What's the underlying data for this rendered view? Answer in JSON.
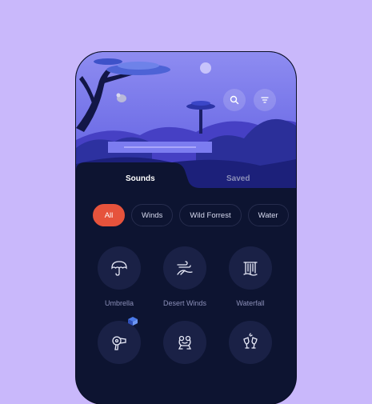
{
  "tabs": {
    "sounds": "Sounds",
    "saved": "Saved"
  },
  "header_icons": [
    "search-icon",
    "filter-icon"
  ],
  "filters": [
    "All",
    "Winds",
    "Wild Forrest",
    "Water"
  ],
  "active_filter": "All",
  "sounds": [
    {
      "label": "Umbrella",
      "icon": "umbrella-icon"
    },
    {
      "label": "Desert Winds",
      "icon": "desert-winds-icon"
    },
    {
      "label": "Waterfall",
      "icon": "waterfall-icon"
    },
    {
      "label": "",
      "icon": "hair-dryer-icon"
    },
    {
      "label": "",
      "icon": "frog-icon"
    },
    {
      "label": "",
      "icon": "cheers-glasses-icon"
    }
  ],
  "colors": {
    "background": "#c9b8fb",
    "panel": "#0d1431",
    "accent": "#e6533c",
    "hero": "#4a4fd1"
  }
}
